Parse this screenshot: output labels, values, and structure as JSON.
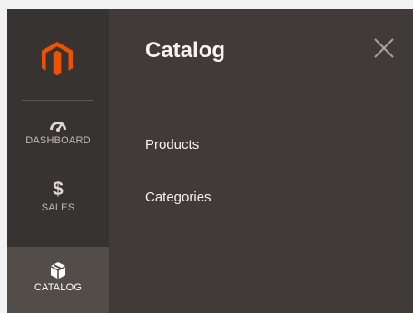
{
  "app": {
    "logo_icon": "magento-logo-icon",
    "accent_color": "#eb5202"
  },
  "sidebar": {
    "items": [
      {
        "id": "dashboard",
        "label": "DASHBOARD",
        "icon": "dashboard-gauge-icon",
        "active": false
      },
      {
        "id": "sales",
        "label": "SALES",
        "icon": "dollar-icon",
        "active": false
      },
      {
        "id": "catalog",
        "label": "CATALOG",
        "icon": "box-icon",
        "active": true
      }
    ]
  },
  "panel": {
    "title": "Catalog",
    "close_icon": "close-icon",
    "links": [
      {
        "label": "Products"
      },
      {
        "label": "Categories"
      }
    ]
  },
  "icons": {
    "sales_glyph": "$"
  },
  "colors": {
    "sidebar_bg": "#373330",
    "panel_bg": "#403b38",
    "active_item_bg": "#524d49",
    "text_light": "#f7f3ef",
    "text_muted": "#c2bcb7"
  }
}
